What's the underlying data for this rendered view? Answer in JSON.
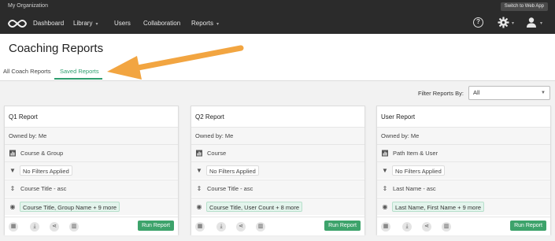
{
  "topbar": {
    "org_name": "My Organization",
    "switch_label": "Switch to Web App",
    "nav": [
      {
        "label": "Dashboard"
      },
      {
        "label": "Library"
      },
      {
        "label": "Users"
      },
      {
        "label": "Collaboration"
      },
      {
        "label": "Reports"
      }
    ],
    "help_glyph": "?"
  },
  "page": {
    "title": "Coaching Reports",
    "tabs": [
      {
        "label": "All Coach Reports"
      },
      {
        "label": "Saved Reports"
      }
    ]
  },
  "filter": {
    "label": "Filter Reports By:",
    "value": "All"
  },
  "colors": {
    "accent": "#2e9e6e",
    "run_button": "#3da36b",
    "annotation_arrow": "#f2a541"
  },
  "cards": [
    {
      "title": "Q1 Report",
      "owner": "Owned by: Me",
      "type": "Course & Group",
      "filters": "No Filters Applied",
      "sort": "Course Title - asc",
      "columns": "Course Title, Group Name + 9 more",
      "run_label": "Run Report"
    },
    {
      "title": "Q2 Report",
      "owner": "Owned by: Me",
      "type": "Course",
      "filters": "No Filters Applied",
      "sort": "Course Title - asc",
      "columns": "Course Title, User Count + 8 more",
      "run_label": "Run Report"
    },
    {
      "title": "User Report",
      "owner": "Owned by: Me",
      "type": "Path Item & User",
      "filters": "No Filters Applied",
      "sort": "Last Name - asc",
      "columns": "Last Name, First Name + 9 more",
      "run_label": "Run Report"
    }
  ]
}
